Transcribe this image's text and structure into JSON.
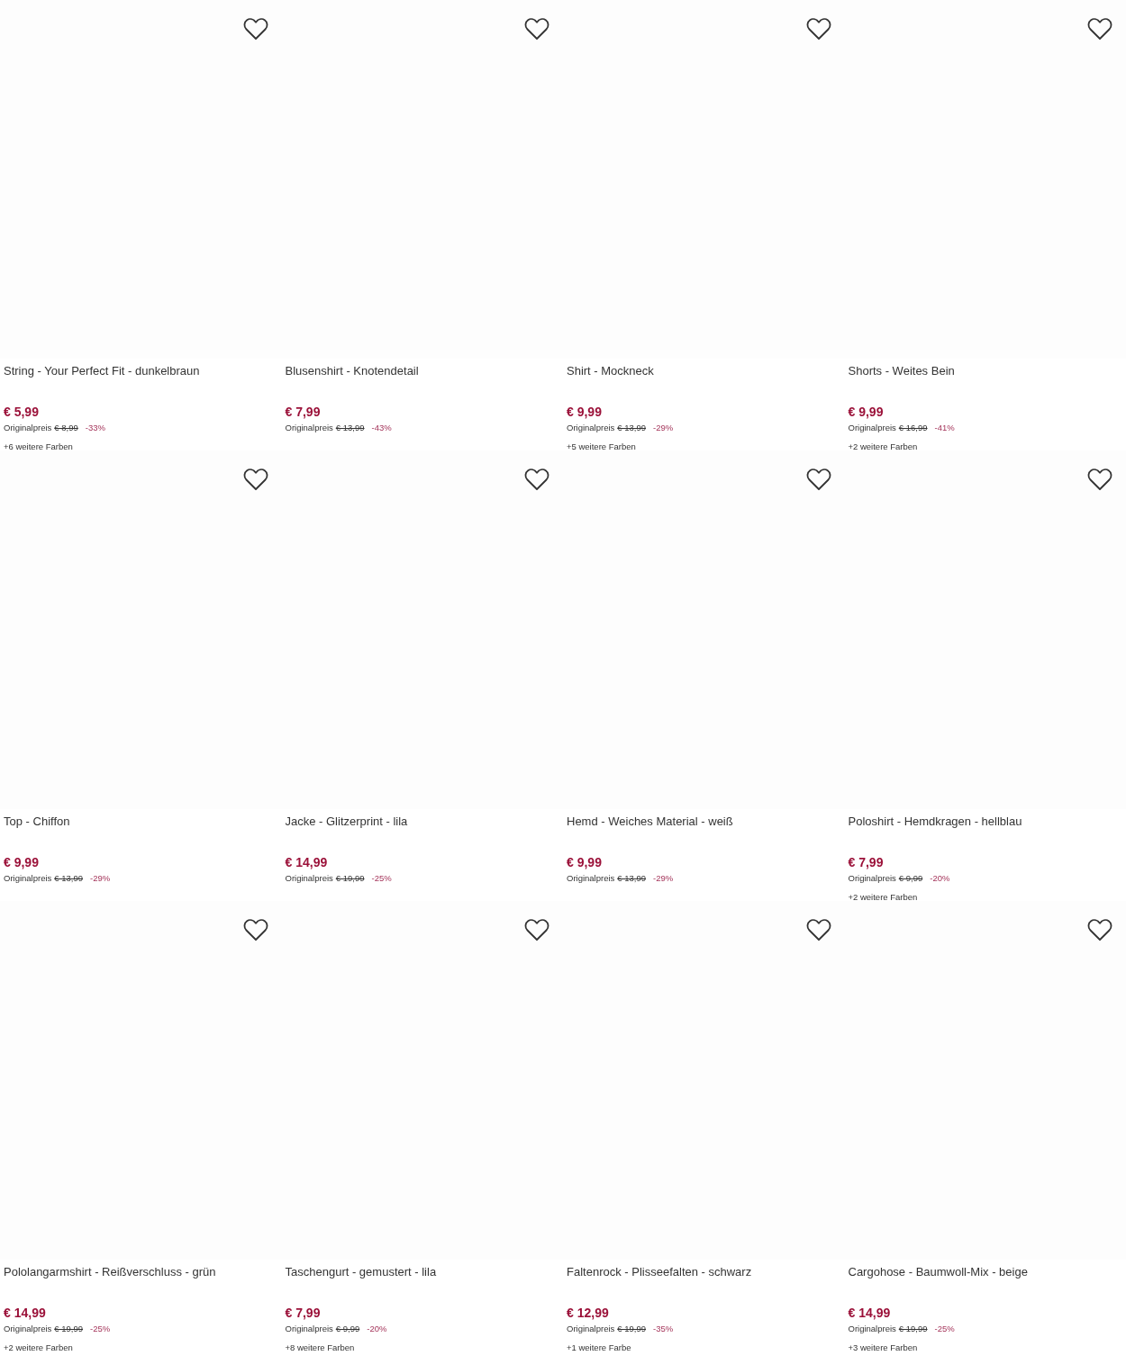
{
  "products": [
    {
      "title": "String - Your Perfect Fit - dunkelbraun",
      "price": "€ 5,99",
      "original_label": "Originalpreis",
      "original_price": "€ 8,99",
      "discount": "-33%",
      "more_colors": "+6 weitere Farben"
    },
    {
      "title": "Blusenshirt - Knotendetail",
      "price": "€ 7,99",
      "original_label": "Originalpreis",
      "original_price": "€ 13,99",
      "discount": "-43%"
    },
    {
      "title": "Shirt - Mockneck",
      "price": "€ 9,99",
      "original_label": "Originalpreis",
      "original_price": "€ 13,99",
      "discount": "-29%",
      "more_colors": "+5 weitere Farben"
    },
    {
      "title": "Shorts - Weites Bein",
      "price": "€ 9,99",
      "original_label": "Originalpreis",
      "original_price": "€ 16,99",
      "discount": "-41%",
      "more_colors": "+2 weitere Farben"
    },
    {
      "title": "Top - Chiffon",
      "price": "€ 9,99",
      "original_label": "Originalpreis",
      "original_price": "€ 13,99",
      "discount": "-29%"
    },
    {
      "title": "Jacke - Glitzerprint - lila",
      "price": "€ 14,99",
      "original_label": "Originalpreis",
      "original_price": "€ 19,99",
      "discount": "-25%"
    },
    {
      "title": "Hemd - Weiches Material - weiß",
      "price": "€ 9,99",
      "original_label": "Originalpreis",
      "original_price": "€ 13,99",
      "discount": "-29%"
    },
    {
      "title": "Poloshirt - Hemdkragen - hellblau",
      "price": "€ 7,99",
      "original_label": "Originalpreis",
      "original_price": "€ 9,99",
      "discount": "-20%",
      "more_colors": "+2 weitere Farben"
    },
    {
      "title": "Pololangarmshirt - Reißverschluss - grün",
      "price": "€ 14,99",
      "original_label": "Originalpreis",
      "original_price": "€ 19,99",
      "discount": "-25%",
      "more_colors": "+2 weitere Farben"
    },
    {
      "title": "Taschengurt - gemustert - lila",
      "price": "€ 7,99",
      "original_label": "Originalpreis",
      "original_price": "€ 9,99",
      "discount": "-20%",
      "more_colors": "+8 weitere Farben"
    },
    {
      "title": "Faltenrock - Plisseefalten - schwarz",
      "price": "€ 12,99",
      "original_label": "Originalpreis",
      "original_price": "€ 19,99",
      "discount": "-35%",
      "more_colors": "+1 weitere Farbe"
    },
    {
      "title": "Cargohose - Baumwoll-Mix - beige",
      "price": "€ 14,99",
      "original_label": "Originalpreis",
      "original_price": "€ 19,99",
      "discount": "-25%",
      "more_colors": "+3 weitere Farben"
    }
  ]
}
